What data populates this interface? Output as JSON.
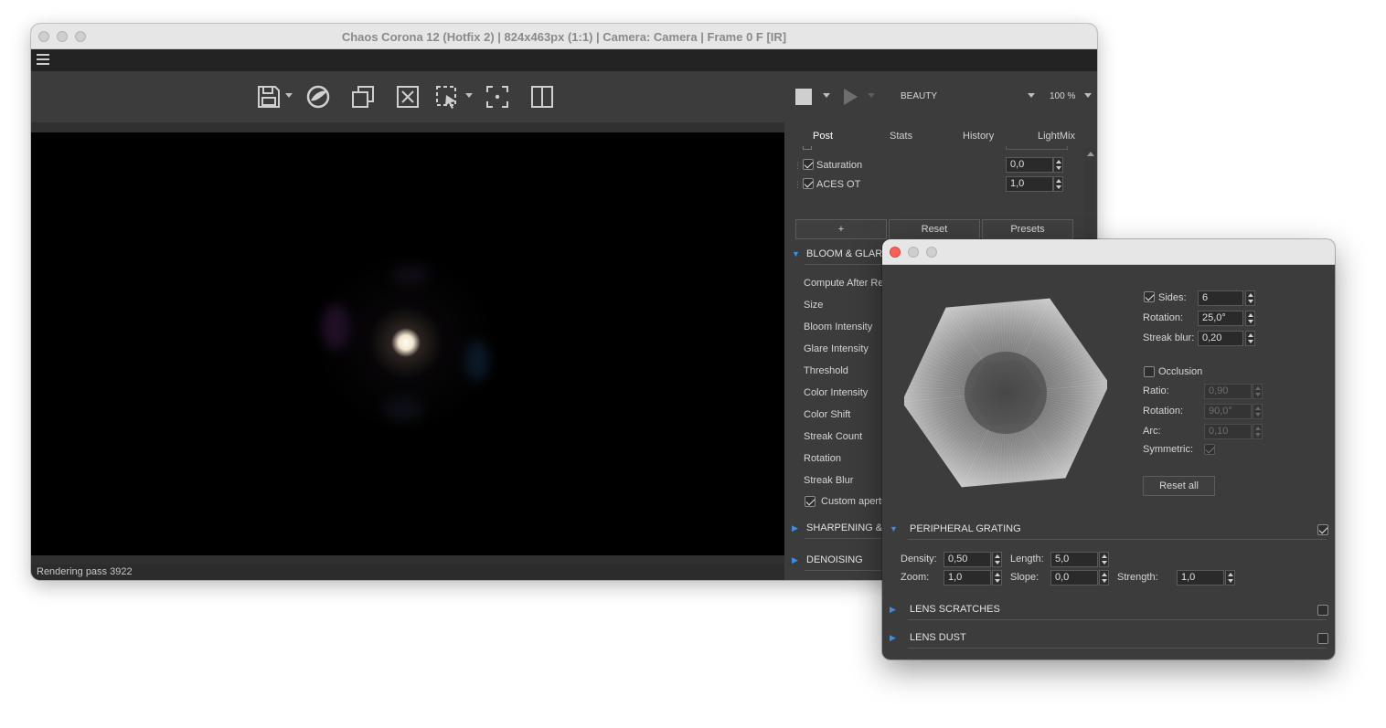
{
  "window": {
    "title": "Chaos Corona 12 (Hotfix 2) | 824x463px (1:1) | Camera: Camera | Frame 0 F [IR]"
  },
  "toolbar": {
    "icons": [
      "save-icon",
      "corona-logo-icon",
      "copy-icon",
      "clear-icon",
      "region-select-icon",
      "focus-point-icon",
      "compare-split-icon",
      "stop-icon",
      "play-icon"
    ],
    "channel": "BEAUTY",
    "zoom": "100 %"
  },
  "status": {
    "text": "Rendering pass 3922"
  },
  "panel": {
    "tabs": [
      "Post",
      "Stats",
      "History",
      "LightMix"
    ],
    "active_tab": "Post",
    "operators": [
      {
        "label": "Saturation",
        "checked": true,
        "value": "0,0"
      },
      {
        "label": "ACES OT",
        "checked": true,
        "value": "1,0"
      }
    ],
    "buttons": {
      "add": "+",
      "reset": "Reset",
      "presets": "Presets"
    },
    "bloom_glare": {
      "title": "BLOOM & GLARE",
      "enabled": true,
      "params": [
        "Compute After Re",
        "Size",
        "Bloom Intensity",
        "Glare Intensity",
        "Threshold",
        "Color Intensity",
        "Color Shift",
        "Streak Count",
        "Rotation",
        "Streak Blur"
      ],
      "custom_aperture": {
        "label": "Custom apertu",
        "checked": true
      }
    },
    "sections_collapsed": [
      "SHARPENING & B",
      "DENOISING"
    ]
  },
  "dialog": {
    "sides": {
      "label": "Sides:",
      "checked": true,
      "value": "6"
    },
    "rotation": {
      "label": "Rotation:",
      "value": "25,0°"
    },
    "streak_blur": {
      "label": "Streak blur:",
      "value": "0,20"
    },
    "occlusion": {
      "label": "Occlusion",
      "checked": false
    },
    "ratio": {
      "label": "Ratio:",
      "value": "0,90"
    },
    "occ_rotation": {
      "label": "Rotation:",
      "value": "90,0°"
    },
    "arc": {
      "label": "Arc:",
      "value": "0,10"
    },
    "symmetric": {
      "label": "Symmetric:",
      "checked": true
    },
    "reset_all": "Reset all",
    "peripheral_grating": {
      "title": "PERIPHERAL GRATING",
      "enabled": true,
      "density": {
        "label": "Density:",
        "value": "0,50"
      },
      "zoom": {
        "label": "Zoom:",
        "value": "1,0"
      },
      "length": {
        "label": "Length:",
        "value": "5,0"
      },
      "slope": {
        "label": "Slope:",
        "value": "0,0"
      },
      "strength": {
        "label": "Strength:",
        "value": "1,0"
      }
    },
    "lens_scratches": {
      "title": "LENS SCRATCHES",
      "enabled": false
    },
    "lens_dust": {
      "title": "LENS DUST",
      "enabled": false
    }
  },
  "colors": {
    "accent": "#3a8ee6",
    "close_red": "#fe5f57",
    "panel_bg": "#3c3c3c"
  }
}
